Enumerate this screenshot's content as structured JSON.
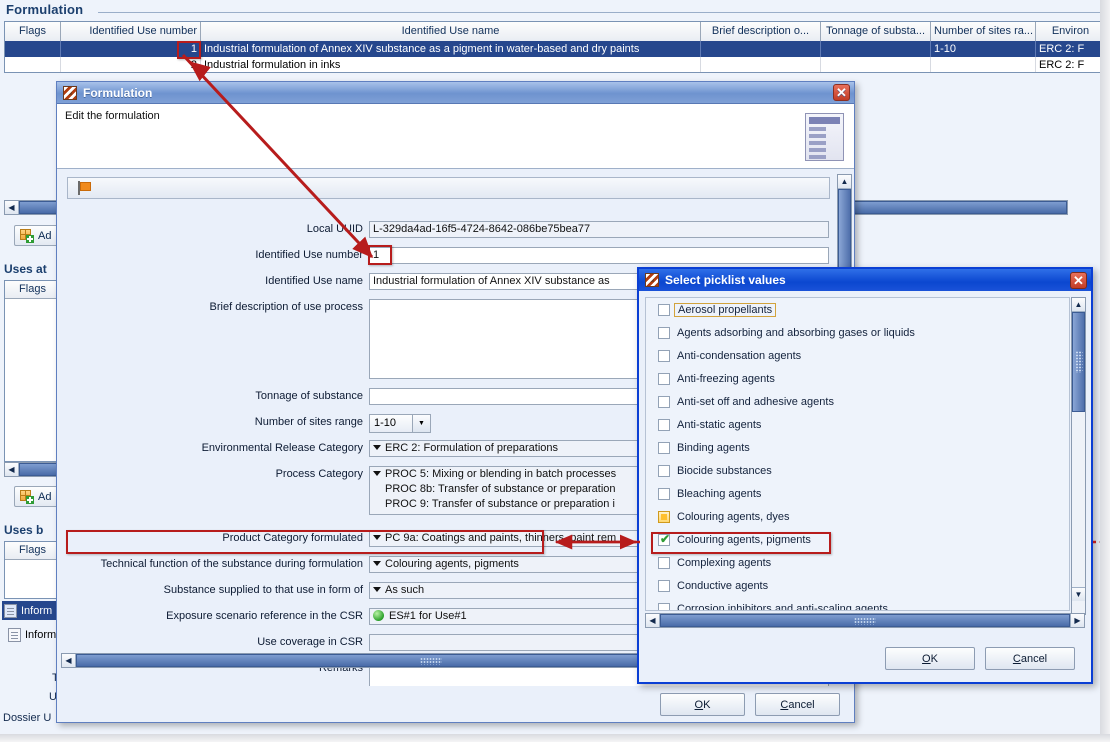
{
  "background": {
    "section_title": "Formulation",
    "table": {
      "headers": [
        "Flags",
        "Identified Use number",
        "Identified Use name",
        "Brief description o...",
        "Tonnage of substa...",
        "Number of sites ra...",
        "Environ"
      ],
      "rows": [
        {
          "flags": "",
          "number": "1",
          "name": "Industrial formulation of Annex XIV substance as a pigment in water-based and dry paints",
          "brief": "",
          "tonnage": "",
          "sites": "1-10",
          "erc": "ERC 2: F"
        },
        {
          "flags": "",
          "number": "2",
          "name": "Industrial formulation in inks",
          "brief": "",
          "tonnage": "",
          "sites": "",
          "erc": "ERC 2: F"
        }
      ]
    },
    "add_button_1": "Ad",
    "add_button_2": "Ad",
    "subheading_uses_at": "Uses at",
    "subheading_uses_by": "Uses b",
    "flags_header_1": "Flags",
    "flags_header_2": "Flags",
    "tree_items": [
      {
        "label": "Inform"
      },
      {
        "label": "Inform"
      }
    ],
    "footer_texts": [
      "T",
      "U",
      "Dossier U"
    ]
  },
  "formulation_dialog": {
    "title": "Formulation",
    "description": "Edit the formulation",
    "fields": [
      {
        "label": "Local UUID",
        "value": "L-329da4ad-16f5-4724-8642-086be75bea77",
        "type": "text-readonly"
      },
      {
        "label": "Identified Use number",
        "value": "1",
        "type": "text"
      },
      {
        "label": "Identified Use name",
        "value": "Industrial formulation of Annex XIV substance as",
        "type": "text"
      },
      {
        "label": "Brief description of use process",
        "value": "",
        "type": "textarea"
      },
      {
        "label": "Tonnage of substance",
        "value": "",
        "type": "text"
      },
      {
        "label": "Number of sites range",
        "value": "1-10",
        "type": "combo-small"
      },
      {
        "label": "Environmental Release Category",
        "value": "ERC 2: Formulation of preparations",
        "type": "picklist"
      },
      {
        "label": "Process Category",
        "value": "PROC 5: Mixing or blending in batch processes",
        "type": "picklist-multi",
        "extra_lines": [
          "PROC 8b: Transfer of substance or preparation",
          "PROC 9: Transfer of substance or preparation i"
        ]
      },
      {
        "label": "Product Category formulated",
        "value": "PC 9a: Coatings and paints, thinners, paint rem",
        "type": "picklist"
      },
      {
        "label": "Technical function of the substance during formulation",
        "value": "Colouring agents, pigments",
        "type": "picklist"
      },
      {
        "label": "Substance supplied to that use in form of",
        "value": "As such",
        "type": "picklist"
      },
      {
        "label": "Exposure scenario reference in the CSR",
        "value": "ES#1 for Use#1",
        "type": "reference"
      },
      {
        "label": "Use coverage in CSR",
        "value": "",
        "type": "text-readonly"
      },
      {
        "label": "Remarks",
        "value": "",
        "type": "textarea"
      }
    ],
    "ok_label": "OK",
    "ok_mnemonic": "O",
    "cancel_label": "Cancel",
    "cancel_mnemonic": "C"
  },
  "picklist_dialog": {
    "title": "Select picklist values",
    "items": [
      {
        "label": "Aerosol propellants",
        "state": "unchecked",
        "focused": true
      },
      {
        "label": "Agents adsorbing and absorbing gases or liquids",
        "state": "unchecked",
        "focused": false
      },
      {
        "label": "Anti-condensation agents",
        "state": "unchecked",
        "focused": false
      },
      {
        "label": "Anti-freezing agents",
        "state": "unchecked",
        "focused": false
      },
      {
        "label": "Anti-set off and adhesive agents",
        "state": "unchecked",
        "focused": false
      },
      {
        "label": "Anti-static agents",
        "state": "unchecked",
        "focused": false
      },
      {
        "label": "Binding agents",
        "state": "unchecked",
        "focused": false
      },
      {
        "label": "Biocide substances",
        "state": "unchecked",
        "focused": false
      },
      {
        "label": "Bleaching agents",
        "state": "unchecked",
        "focused": false
      },
      {
        "label": "Colouring agents, dyes",
        "state": "partial",
        "focused": false
      },
      {
        "label": "Colouring agents, pigments",
        "state": "checked",
        "focused": false
      },
      {
        "label": "Complexing agents",
        "state": "unchecked",
        "focused": false
      },
      {
        "label": "Conductive agents",
        "state": "unchecked",
        "focused": false
      },
      {
        "label": "Corrosion inhibitors and anti-scaling agents",
        "state": "unchecked",
        "focused": false
      }
    ],
    "ok_label": "OK",
    "cancel_label": "Cancel"
  },
  "colors": {
    "annotation_red": "#b71c1c",
    "selection_blue": "#26478d",
    "dialog_blue": "#0b47d0",
    "heading_blue": "#1b3f6e"
  }
}
